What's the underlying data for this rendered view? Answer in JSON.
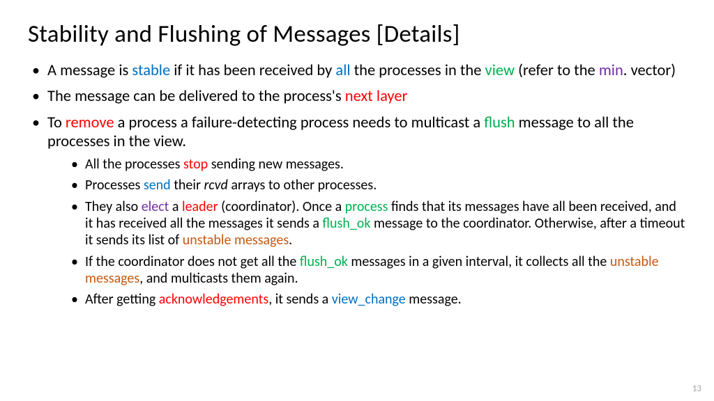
{
  "title": "Stability and Flushing of Messages [Details]",
  "bullets": {
    "b1": {
      "p1": " A message is ",
      "stable": "stable",
      "p2": " if it has been received by ",
      "all": "all",
      "p3": " the processes in the ",
      "view": "view",
      "p4": " (refer to the ",
      "min": "min",
      "p5": ". vector)"
    },
    "b2": {
      "p1": "The message can be delivered to the process's ",
      "next_layer": "next layer"
    },
    "b3": {
      "p1": "To ",
      "remove": "remove",
      "p2": " a process a failure-detecting process needs to multicast a ",
      "flush": "flush",
      "p3": " message to all the processes in the view."
    }
  },
  "subs": {
    "s1": {
      "p1": "All the processes ",
      "stop": "stop",
      "p2": " sending new messages."
    },
    "s2": {
      "p1": "Processes ",
      "send": "send",
      "p2": " their ",
      "rcvd": "rcvd",
      "p3": " arrays to other processes."
    },
    "s3": {
      "p1": "They also ",
      "elect": "elect",
      "p2": " a ",
      "leader": "leader",
      "p3": " (coordinator). Once a ",
      "process": "process",
      "p4": " finds that its messages have all been received, and it has received all the messages it sends a ",
      "flush_ok": "flush_ok",
      "p5": " message to the coordinator. Otherwise, after a timeout it sends its list of ",
      "unstable": "unstable messages",
      "p6": "."
    },
    "s4": {
      "p1": "If the coordinator does not get all the ",
      "flush_ok": "flush_ok",
      "p2": " messages in a given interval, it collects all the ",
      "unstable": "unstable messages",
      "p3": ", and multicasts them again."
    },
    "s5": {
      "p1": "After getting ",
      "ack": "acknowledgements",
      "p2": ", it sends a ",
      "view_change": "view_change",
      "p3": " message."
    }
  },
  "page_number": "13"
}
